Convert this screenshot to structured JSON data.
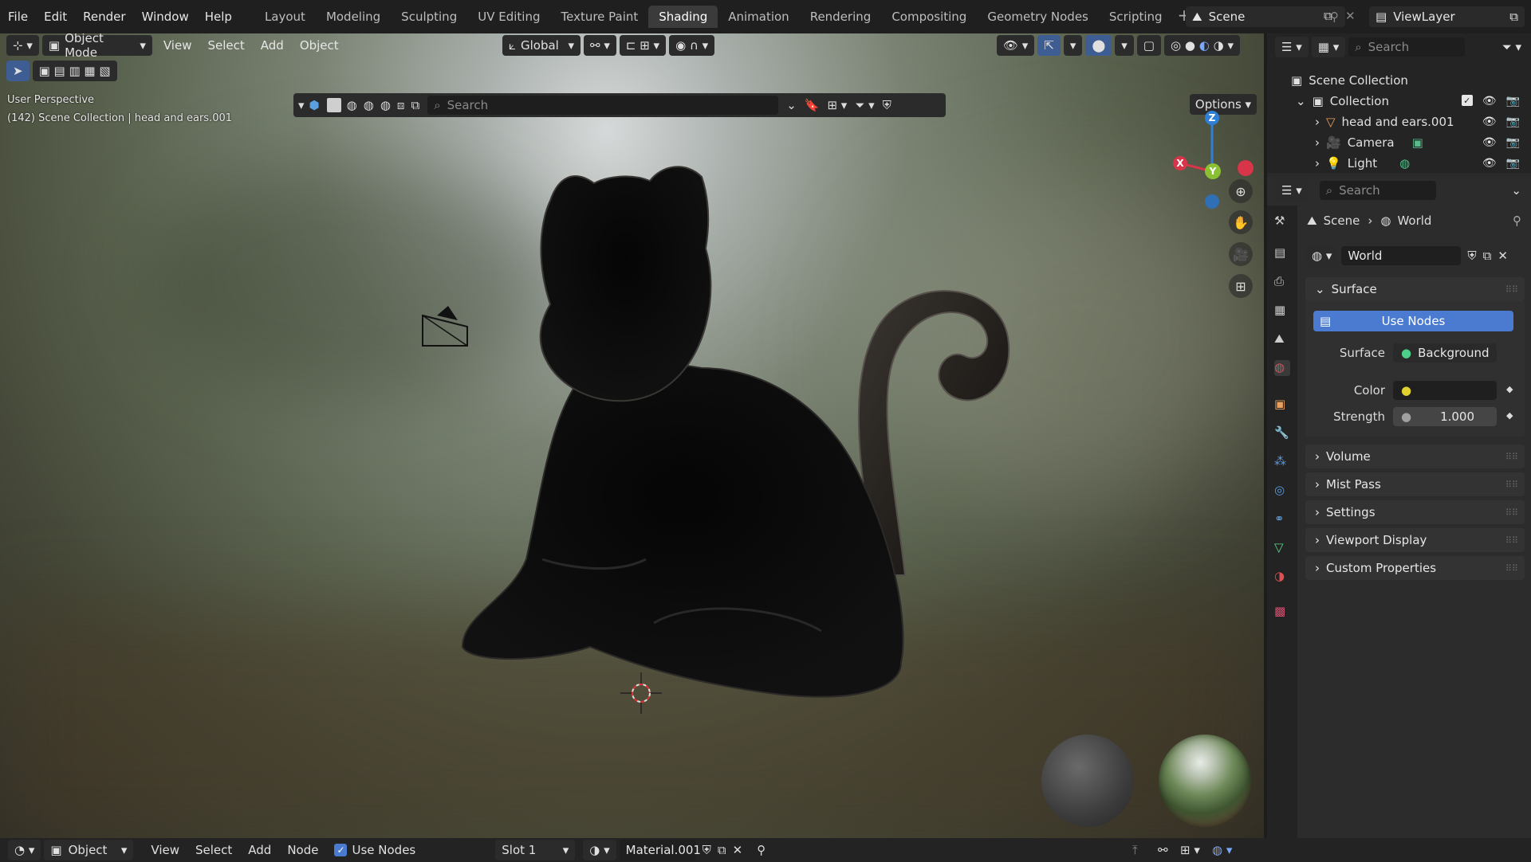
{
  "top_menu": [
    "File",
    "Edit",
    "Render",
    "Window",
    "Help"
  ],
  "workspace_tabs": [
    "Layout",
    "Modeling",
    "Sculpting",
    "UV Editing",
    "Texture Paint",
    "Shading",
    "Animation",
    "Rendering",
    "Compositing",
    "Geometry Nodes",
    "Scripting"
  ],
  "active_workspace": "Shading",
  "scene_name": "Scene",
  "view_layer": "ViewLayer",
  "viewport_header": {
    "mode": "Object Mode",
    "menus": [
      "View",
      "Select",
      "Add",
      "Object"
    ],
    "transform_orientation": "Global",
    "options_label": "Options"
  },
  "toolbar2": {
    "search_placeholder": "Search"
  },
  "viewport_overlay": {
    "perspective": "User Perspective",
    "collection_info": "(142) Scene Collection | head and ears.001"
  },
  "gizmo": {
    "x": "X",
    "y": "Y",
    "z": "Z"
  },
  "outliner": {
    "search_placeholder": "Search",
    "root": "Scene Collection",
    "collection": "Collection",
    "items": [
      "head and ears.001",
      "Camera",
      "Light"
    ]
  },
  "properties": {
    "search_placeholder": "Search",
    "breadcrumb_scene": "Scene",
    "breadcrumb_world": "World",
    "world_name": "World",
    "surface_panel": "Surface",
    "use_nodes_label": "Use Nodes",
    "surface_label": "Surface",
    "surface_value": "Background",
    "color_label": "Color",
    "strength_label": "Strength",
    "strength_value": "1.000",
    "collapsed_panels": [
      "Volume",
      "Mist Pass",
      "Settings",
      "Viewport Display",
      "Custom Properties"
    ]
  },
  "bottom_bar": {
    "editor_mode": "Object",
    "menus": [
      "View",
      "Select",
      "Add",
      "Node"
    ],
    "use_nodes": "Use Nodes",
    "slot": "Slot 1",
    "material": "Material.001"
  },
  "colors": {
    "accent_blue": "#4b7bd0",
    "axis_x": "#d8344a",
    "axis_y": "#8bc034",
    "axis_z": "#2f7fd6"
  }
}
